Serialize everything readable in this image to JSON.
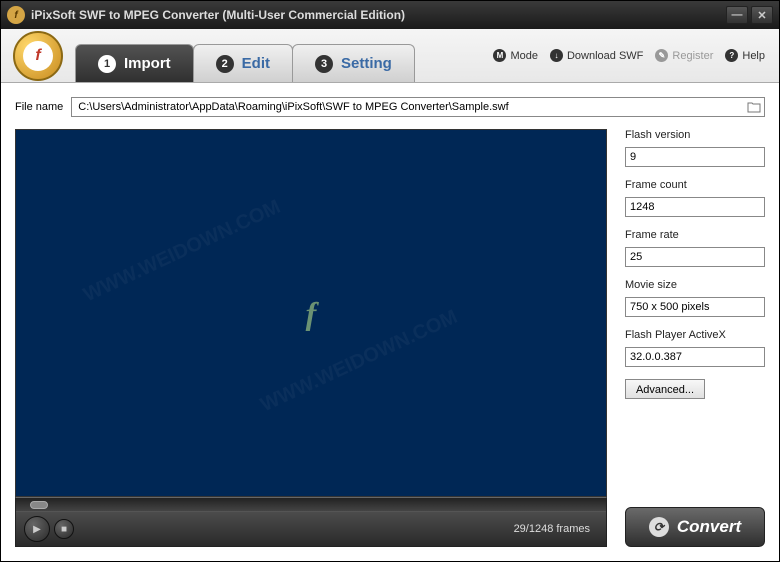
{
  "titlebar": {
    "title": "iPixSoft SWF to MPEG Converter (Multi-User Commercial Edition)"
  },
  "tabs": [
    {
      "num": "1",
      "label": "Import",
      "active": true
    },
    {
      "num": "2",
      "label": "Edit",
      "active": false
    },
    {
      "num": "3",
      "label": "Setting",
      "active": false
    }
  ],
  "headerLinks": {
    "mode": "Mode",
    "download": "Download SWF",
    "register": "Register",
    "help": "Help"
  },
  "file": {
    "label": "File name",
    "value": "C:\\Users\\Administrator\\AppData\\Roaming\\iPixSoft\\SWF to MPEG Converter\\Sample.swf"
  },
  "info": {
    "flashVersionLabel": "Flash version",
    "flashVersion": "9",
    "frameCountLabel": "Frame count",
    "frameCount": "1248",
    "frameRateLabel": "Frame rate",
    "frameRate": "25",
    "movieSizeLabel": "Movie size",
    "movieSize": "750 x 500 pixels",
    "activeXLabel": "Flash Player ActiveX",
    "activeX": "32.0.0.387",
    "advanced": "Advanced..."
  },
  "player": {
    "frames": "29/1248 frames"
  },
  "convert": {
    "label": "Convert"
  }
}
